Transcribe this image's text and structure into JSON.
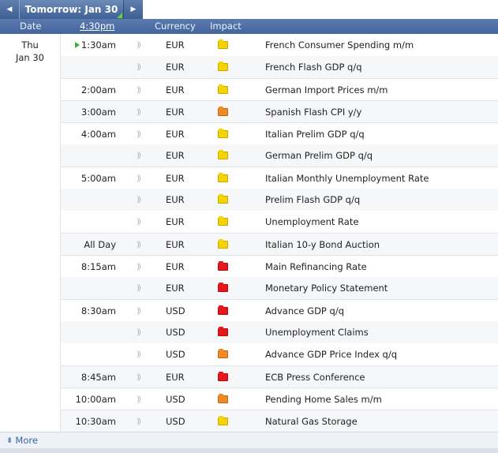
{
  "nav": {
    "prev_icon": "◀",
    "next_icon": "▶",
    "day_label": "Tomorrow: Jan 30"
  },
  "header": {
    "date": "Date",
    "time": "4:30pm",
    "currency": "Currency",
    "impact": "Impact"
  },
  "date": {
    "weekday": "Thu",
    "day": "Jan 30"
  },
  "rows": [
    {
      "time": "1:30am",
      "currency": "EUR",
      "impact": "yellow",
      "event": "French Consumer Spending m/m",
      "group_start": true,
      "playing": true
    },
    {
      "time": "",
      "currency": "EUR",
      "impact": "yellow",
      "event": "French Flash GDP q/q",
      "group_start": false
    },
    {
      "time": "2:00am",
      "currency": "EUR",
      "impact": "yellow",
      "event": "German Import Prices m/m",
      "group_start": true
    },
    {
      "time": "3:00am",
      "currency": "EUR",
      "impact": "orange",
      "event": "Spanish Flash CPI y/y",
      "group_start": true
    },
    {
      "time": "4:00am",
      "currency": "EUR",
      "impact": "yellow",
      "event": "Italian Prelim GDP q/q",
      "group_start": true
    },
    {
      "time": "",
      "currency": "EUR",
      "impact": "yellow",
      "event": "German Prelim GDP q/q",
      "group_start": false
    },
    {
      "time": "5:00am",
      "currency": "EUR",
      "impact": "yellow",
      "event": "Italian Monthly Unemployment Rate",
      "group_start": true
    },
    {
      "time": "",
      "currency": "EUR",
      "impact": "yellow",
      "event": "Prelim Flash GDP q/q",
      "group_start": false
    },
    {
      "time": "",
      "currency": "EUR",
      "impact": "yellow",
      "event": "Unemployment Rate",
      "group_start": false
    },
    {
      "time": "All Day",
      "currency": "EUR",
      "impact": "yellow",
      "event": "Italian 10-y Bond Auction",
      "group_start": true
    },
    {
      "time": "8:15am",
      "currency": "EUR",
      "impact": "red",
      "event": "Main Refinancing Rate",
      "group_start": true
    },
    {
      "time": "",
      "currency": "EUR",
      "impact": "red",
      "event": "Monetary Policy Statement",
      "group_start": false
    },
    {
      "time": "8:30am",
      "currency": "USD",
      "impact": "red",
      "event": "Advance GDP q/q",
      "group_start": true
    },
    {
      "time": "",
      "currency": "USD",
      "impact": "red",
      "event": "Unemployment Claims",
      "group_start": false
    },
    {
      "time": "",
      "currency": "USD",
      "impact": "orange",
      "event": "Advance GDP Price Index q/q",
      "group_start": false
    },
    {
      "time": "8:45am",
      "currency": "EUR",
      "impact": "red",
      "event": "ECB Press Conference",
      "group_start": true
    },
    {
      "time": "10:00am",
      "currency": "USD",
      "impact": "orange",
      "event": "Pending Home Sales m/m",
      "group_start": true
    },
    {
      "time": "10:30am",
      "currency": "USD",
      "impact": "yellow",
      "event": "Natural Gas Storage",
      "group_start": true
    }
  ],
  "footer": {
    "more_icon": "⇟",
    "more_label": "More"
  },
  "colors": {
    "impact_yellow": "#f5d300",
    "impact_orange": "#f08a24",
    "impact_red": "#e8161a",
    "header_blue": "#44659d",
    "link_blue": "#3a64a8"
  }
}
